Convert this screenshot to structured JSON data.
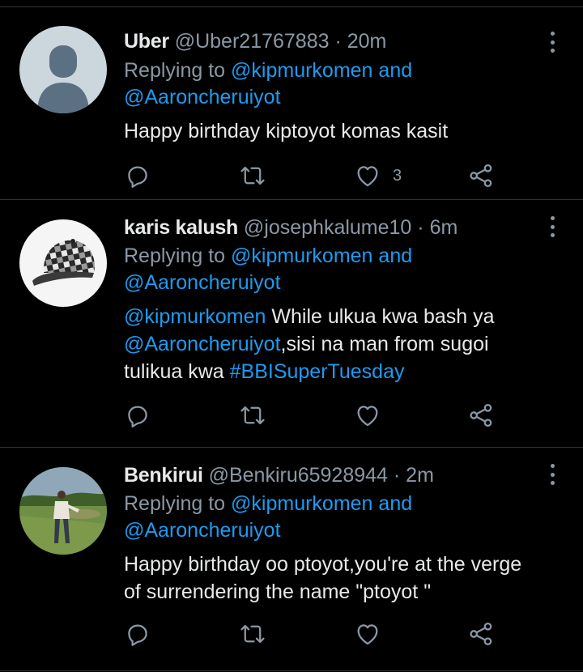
{
  "tweets": [
    {
      "name": "Uber",
      "handle": "@Uber21767883",
      "sep": " · ",
      "time": "20m",
      "replying_prefix": "Replying to ",
      "mention1": "@kipmurkomen",
      "and": " and",
      "mention2": "@Aaroncheruiyot",
      "body": "Happy birthday kiptoyot komas kasit",
      "like_count": "3",
      "avatar": "default-profile-silhouette"
    },
    {
      "name": "karis kalush",
      "handle": "@josephkalume10",
      "sep": " · ",
      "time": "6m",
      "replying_prefix": "Replying to ",
      "mention1": "@kipmurkomen",
      "and": " and",
      "mention2": "@Aaroncheruiyot",
      "body_parts": {
        "m1": "@kipmurkomen",
        "t1": " While ulkua kwa bash ya ",
        "m2": "@Aaroncheruiyot",
        "t2": ",sisi na man from sugoi tulikua kwa ",
        "tag": "#BBISuperTuesday"
      },
      "like_count": "",
      "avatar": "checkered-cap-photo"
    },
    {
      "name": "Benkirui",
      "handle": "@Benkiru65928944",
      "sep": " · ",
      "time": "2m",
      "replying_prefix": "Replying to ",
      "mention1": "@kipmurkomen",
      "and": " and",
      "mention2": "@Aaroncheruiyot",
      "body": "Happy birthday oo ptoyot,you're at the verge of surrendering the name \"ptoyot \"",
      "like_count": "",
      "avatar": "man-on-grass-photo"
    }
  ],
  "colors": {
    "background": "#000000",
    "text": "#e7e9ea",
    "muted": "#8b98a5",
    "link": "#1d9bf0",
    "divider": "#2f3336"
  },
  "icons": [
    "reply-icon",
    "retweet-icon",
    "like-icon",
    "share-icon",
    "more-options-icon"
  ]
}
